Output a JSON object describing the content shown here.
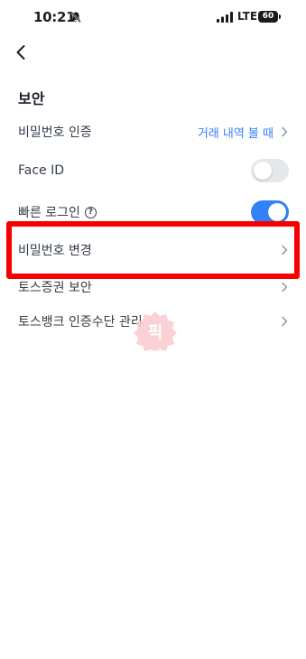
{
  "status_bar": {
    "time": "10:21",
    "network": "LTE",
    "battery": "60"
  },
  "header": {
    "back_icon": "chevron-left-icon"
  },
  "section": {
    "title": "보안"
  },
  "rows": [
    {
      "label": "비밀번호 인증",
      "value": "거래 내역 볼 때",
      "accessory": "chevron"
    },
    {
      "label": "Face ID",
      "accessory": "toggle",
      "toggle_on": false
    },
    {
      "label": "빠른 로그인",
      "help_icon": "?",
      "accessory": "toggle",
      "toggle_on": true
    },
    {
      "label": "비밀번호 변경",
      "accessory": "chevron",
      "highlighted": true
    },
    {
      "label": "토스증권 보안",
      "accessory": "chevron"
    },
    {
      "label": "토스뱅크 인증수단 관리",
      "accessory": "chevron"
    }
  ],
  "watermark": {
    "text": "픽"
  },
  "colors": {
    "accent": "#3182f6",
    "highlight": "#f70000",
    "toggle_off": "#e5e8eb",
    "text_primary": "#191f28",
    "text_row": "#333d4b",
    "chevron": "#8b95a1"
  }
}
